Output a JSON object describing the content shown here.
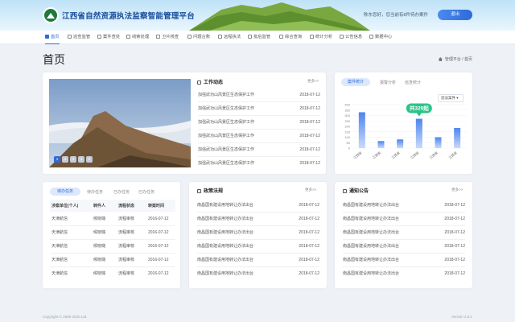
{
  "header": {
    "system_title": "江西省自然资源执法监察智能管理平台",
    "greeting": "陈东您好，您当前有8件待办案件",
    "logout_label": "退出"
  },
  "nav": {
    "items": [
      {
        "label": "首页"
      },
      {
        "label": "巡查监管"
      },
      {
        "label": "案件查处"
      },
      {
        "label": "线索处理"
      },
      {
        "label": "卫片核查"
      },
      {
        "label": "问题台账"
      },
      {
        "label": "远程执法"
      },
      {
        "label": "批后监管"
      },
      {
        "label": "综合查询"
      },
      {
        "label": "统计分析"
      },
      {
        "label": "公告信息"
      },
      {
        "label": "数据中心"
      }
    ]
  },
  "page": {
    "title": "首页",
    "breadcrumb": "管理平台 / 首页"
  },
  "slider": {
    "pages": [
      "1",
      "2",
      "3",
      "4",
      "5"
    ]
  },
  "work": {
    "title": "工作动态",
    "more": "更多>>",
    "items": [
      {
        "text": "加强武功山风景区生态保护工作",
        "date": "2018-07-12"
      },
      {
        "text": "加强武功山风景区生态保护工作",
        "date": "2018-07-12"
      },
      {
        "text": "加强武功山风景区生态保护工作",
        "date": "2018-07-12"
      },
      {
        "text": "加强武功山风景区生态保护工作",
        "date": "2018-07-12"
      },
      {
        "text": "加强武功山风景区生态保护工作",
        "date": "2018-07-12"
      },
      {
        "text": "加强武功山风景区生态保护工作",
        "date": "2018-07-12"
      }
    ]
  },
  "stats": {
    "tabs": [
      "案件统计",
      "报警分析",
      "巡查统计"
    ],
    "select": "违法案件",
    "callout": "共320起"
  },
  "chart_data": {
    "type": "bar",
    "categories": [
      "江西省",
      "江西省",
      "江西省",
      "江西省",
      "江西省",
      "江西省"
    ],
    "values": [
      330,
      65,
      80,
      270,
      100,
      185
    ],
    "ylim": [
      0,
      400
    ],
    "yticks": [
      0,
      50,
      100,
      150,
      200,
      250,
      300,
      350,
      400
    ],
    "highlight_index": 3,
    "grid": true
  },
  "tasks": {
    "tabs": [
      "待办任务",
      "待办任务",
      "已办任务",
      "已办任务"
    ],
    "headers": [
      "涉案单位(个人)",
      "转件人",
      "流程状态",
      "转案时间"
    ],
    "rows": [
      {
        "a": "天津航信",
        "b": "候晓璐",
        "c": "流程审核",
        "d": "2016-07-12"
      },
      {
        "a": "天津航信",
        "b": "候晓璐",
        "c": "流程审核",
        "d": "2016-07-12"
      },
      {
        "a": "天津航信",
        "b": "候晓璐",
        "c": "流程审核",
        "d": "2016-07-12"
      },
      {
        "a": "天津航信",
        "b": "候晓璐",
        "c": "流程审核",
        "d": "2016-07-12"
      },
      {
        "a": "天津航信",
        "b": "候晓璐",
        "c": "流程审核",
        "d": "2016-07-12"
      }
    ]
  },
  "policy": {
    "title": "政策法规",
    "more": "更多>>",
    "items": [
      {
        "text": "南昌国有建设用地转让办法出台",
        "date": "2018-07-12"
      },
      {
        "text": "南昌国有建设用地转让办法出台",
        "date": "2018-07-12"
      },
      {
        "text": "南昌国有建设用地转让办法出台",
        "date": "2018-07-12"
      },
      {
        "text": "南昌国有建设用地转让办法出台",
        "date": "2018-07-12"
      },
      {
        "text": "南昌国有建设用地转让办法出台",
        "date": "2018-07-12"
      },
      {
        "text": "南昌国有建设用地转让办法出台",
        "date": "2018-07-12"
      }
    ]
  },
  "notice": {
    "title": "通知公告",
    "more": "更多>>",
    "items": [
      {
        "text": "南昌国有建设用地转让办法出台",
        "date": "2018-07-12"
      },
      {
        "text": "南昌国有建设用地转让办法出台",
        "date": "2018-07-12"
      },
      {
        "text": "南昌国有建设用地转让办法出台",
        "date": "2018-07-12"
      },
      {
        "text": "南昌国有建设用地转让办法出台",
        "date": "2018-07-12"
      },
      {
        "text": "南昌国有建设用地转让办法出台",
        "date": "2018-07-12"
      },
      {
        "text": "南昌国有建设用地转让办法出台",
        "date": "2018-07-12"
      }
    ]
  },
  "footer": {
    "copyright": "Copyright © 2006-2020 Ltd.",
    "version": "Version 2.0.1"
  }
}
